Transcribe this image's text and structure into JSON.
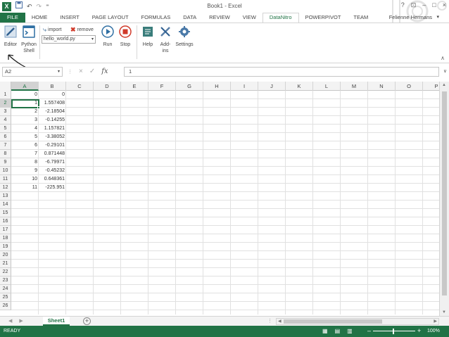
{
  "window": {
    "title": "Book1 - Excel",
    "app_icon_letter": "X",
    "accent_color": "#217346",
    "controls": [
      "?",
      "⊡",
      "–",
      "□",
      "×"
    ]
  },
  "ribbon_tabs": [
    {
      "label": "FILE"
    },
    {
      "label": "HOME"
    },
    {
      "label": "INSERT"
    },
    {
      "label": "PAGE LAYOUT"
    },
    {
      "label": "FORMULAS"
    },
    {
      "label": "DATA"
    },
    {
      "label": "REVIEW"
    },
    {
      "label": "VIEW"
    },
    {
      "label": "DataNitro"
    },
    {
      "label": "POWERPIVOT"
    },
    {
      "label": "TEAM"
    }
  ],
  "user": {
    "name": "Felienne Hermans"
  },
  "ribbon": {
    "editor_label": "Editor",
    "python_shell_label_1": "Python",
    "python_shell_label_2": "Shell",
    "import_label": "import",
    "remove_label": "remove",
    "file_selected": "hello_world.py",
    "run_label": "Run",
    "stop_label": "Stop",
    "help_label": "Help",
    "addins_label_1": "Add-",
    "addins_label_2": "ins",
    "settings_label": "Settings"
  },
  "formula_bar": {
    "name_box": "A2",
    "cancel_icon": "×",
    "enter_icon": "✓",
    "fx_icon": "fx",
    "content": "1"
  },
  "grid": {
    "columns": [
      "A",
      "B",
      "C",
      "D",
      "E",
      "F",
      "G",
      "H",
      "I",
      "J",
      "K",
      "L",
      "M",
      "N",
      "O",
      "P"
    ],
    "rows": [
      "1",
      "2",
      "3",
      "4",
      "5",
      "6",
      "7",
      "8",
      "9",
      "10",
      "11",
      "12",
      "13",
      "14",
      "15",
      "16",
      "17",
      "18",
      "19",
      "20",
      "21",
      "22",
      "23",
      "24",
      "25",
      "26"
    ],
    "selected_column": "A",
    "selected_row": "2",
    "cells": [
      {
        "a": "0",
        "b": "0"
      },
      {
        "a": "1",
        "b": "1.557408"
      },
      {
        "a": "2",
        "b": "-2.18504"
      },
      {
        "a": "3",
        "b": "-0.14255"
      },
      {
        "a": "4",
        "b": "1.157821"
      },
      {
        "a": "5",
        "b": "-3.38052"
      },
      {
        "a": "6",
        "b": "-0.29101"
      },
      {
        "a": "7",
        "b": "0.871448"
      },
      {
        "a": "8",
        "b": "-6.79971"
      },
      {
        "a": "9",
        "b": "-0.45232"
      },
      {
        "a": "10",
        "b": "0.648361"
      },
      {
        "a": "11",
        "b": "-225.951"
      }
    ]
  },
  "sheets": {
    "tabs": [
      "Sheet1"
    ],
    "add_icon": "+"
  },
  "status": {
    "text": "READY",
    "zoom": "100%",
    "zoom_minus": "–",
    "zoom_plus": "+"
  }
}
